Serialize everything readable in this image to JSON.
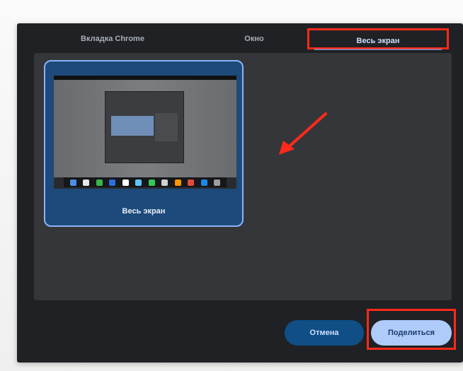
{
  "tabs": [
    {
      "label": "Вкладка Chrome"
    },
    {
      "label": "Окно"
    },
    {
      "label": "Весь экран",
      "selected": true
    }
  ],
  "source": {
    "label": "Весь экран",
    "selected": true
  },
  "buttons": {
    "cancel": "Отмена",
    "share": "Поделиться"
  },
  "colors": {
    "highlight": "#ff2a1a",
    "dialog_bg": "#1f2124",
    "panel_bg": "#35363a",
    "card_bg": "#1d4a7a",
    "accent": "#8ab4f8",
    "primary_button": "#aecbfa",
    "secondary_button": "#0f4f86"
  },
  "annotations": {
    "arrow_icon": "red-arrow-icon"
  }
}
